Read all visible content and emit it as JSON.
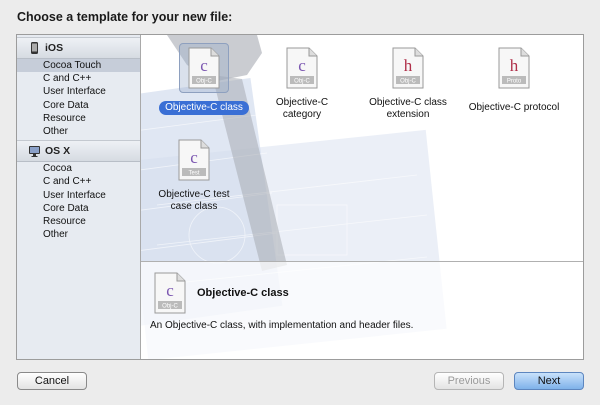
{
  "dialog": {
    "title": "Choose a template for your new file:"
  },
  "sidebar": {
    "sections": [
      {
        "header": "iOS",
        "icon": "iphone-icon",
        "items": [
          "Cocoa Touch",
          "C and C++",
          "User Interface",
          "Core Data",
          "Resource",
          "Other"
        ],
        "selected_index": 0
      },
      {
        "header": "OS X",
        "icon": "mac-icon",
        "items": [
          "Cocoa",
          "C and C++",
          "User Interface",
          "Core Data",
          "Resource",
          "Other"
        ],
        "selected_index": -1
      }
    ]
  },
  "templates": [
    {
      "label": "Objective-C class",
      "badge": "Obj-C",
      "glyph": "c",
      "icon": "objc-class-file-icon",
      "selected": true
    },
    {
      "label": "Objective-C category",
      "badge": "Obj-C",
      "glyph": "c",
      "icon": "objc-category-file-icon",
      "selected": false
    },
    {
      "label": "Objective-C class extension",
      "badge": "Obj-C",
      "glyph": "h",
      "icon": "objc-extension-file-icon",
      "selected": false
    },
    {
      "label": "Objective-C protocol",
      "badge": "Proto",
      "glyph": "h",
      "icon": "objc-protocol-file-icon",
      "selected": false
    },
    {
      "label": "Objective-C test case class",
      "badge": "Test",
      "glyph": "c",
      "icon": "objc-test-file-icon",
      "selected": false
    }
  ],
  "detail": {
    "title": "Objective-C class",
    "description": "An Objective-C class, with implementation and header files.",
    "badge": "Obj-C"
  },
  "buttons": {
    "cancel": "Cancel",
    "previous": "Previous",
    "next": "Next"
  },
  "colors": {
    "selection": "#3a6fd5",
    "sidebar_bg": "#e7ebf1",
    "c_glyph": "#7a55b0",
    "h_glyph": "#b0304a"
  }
}
